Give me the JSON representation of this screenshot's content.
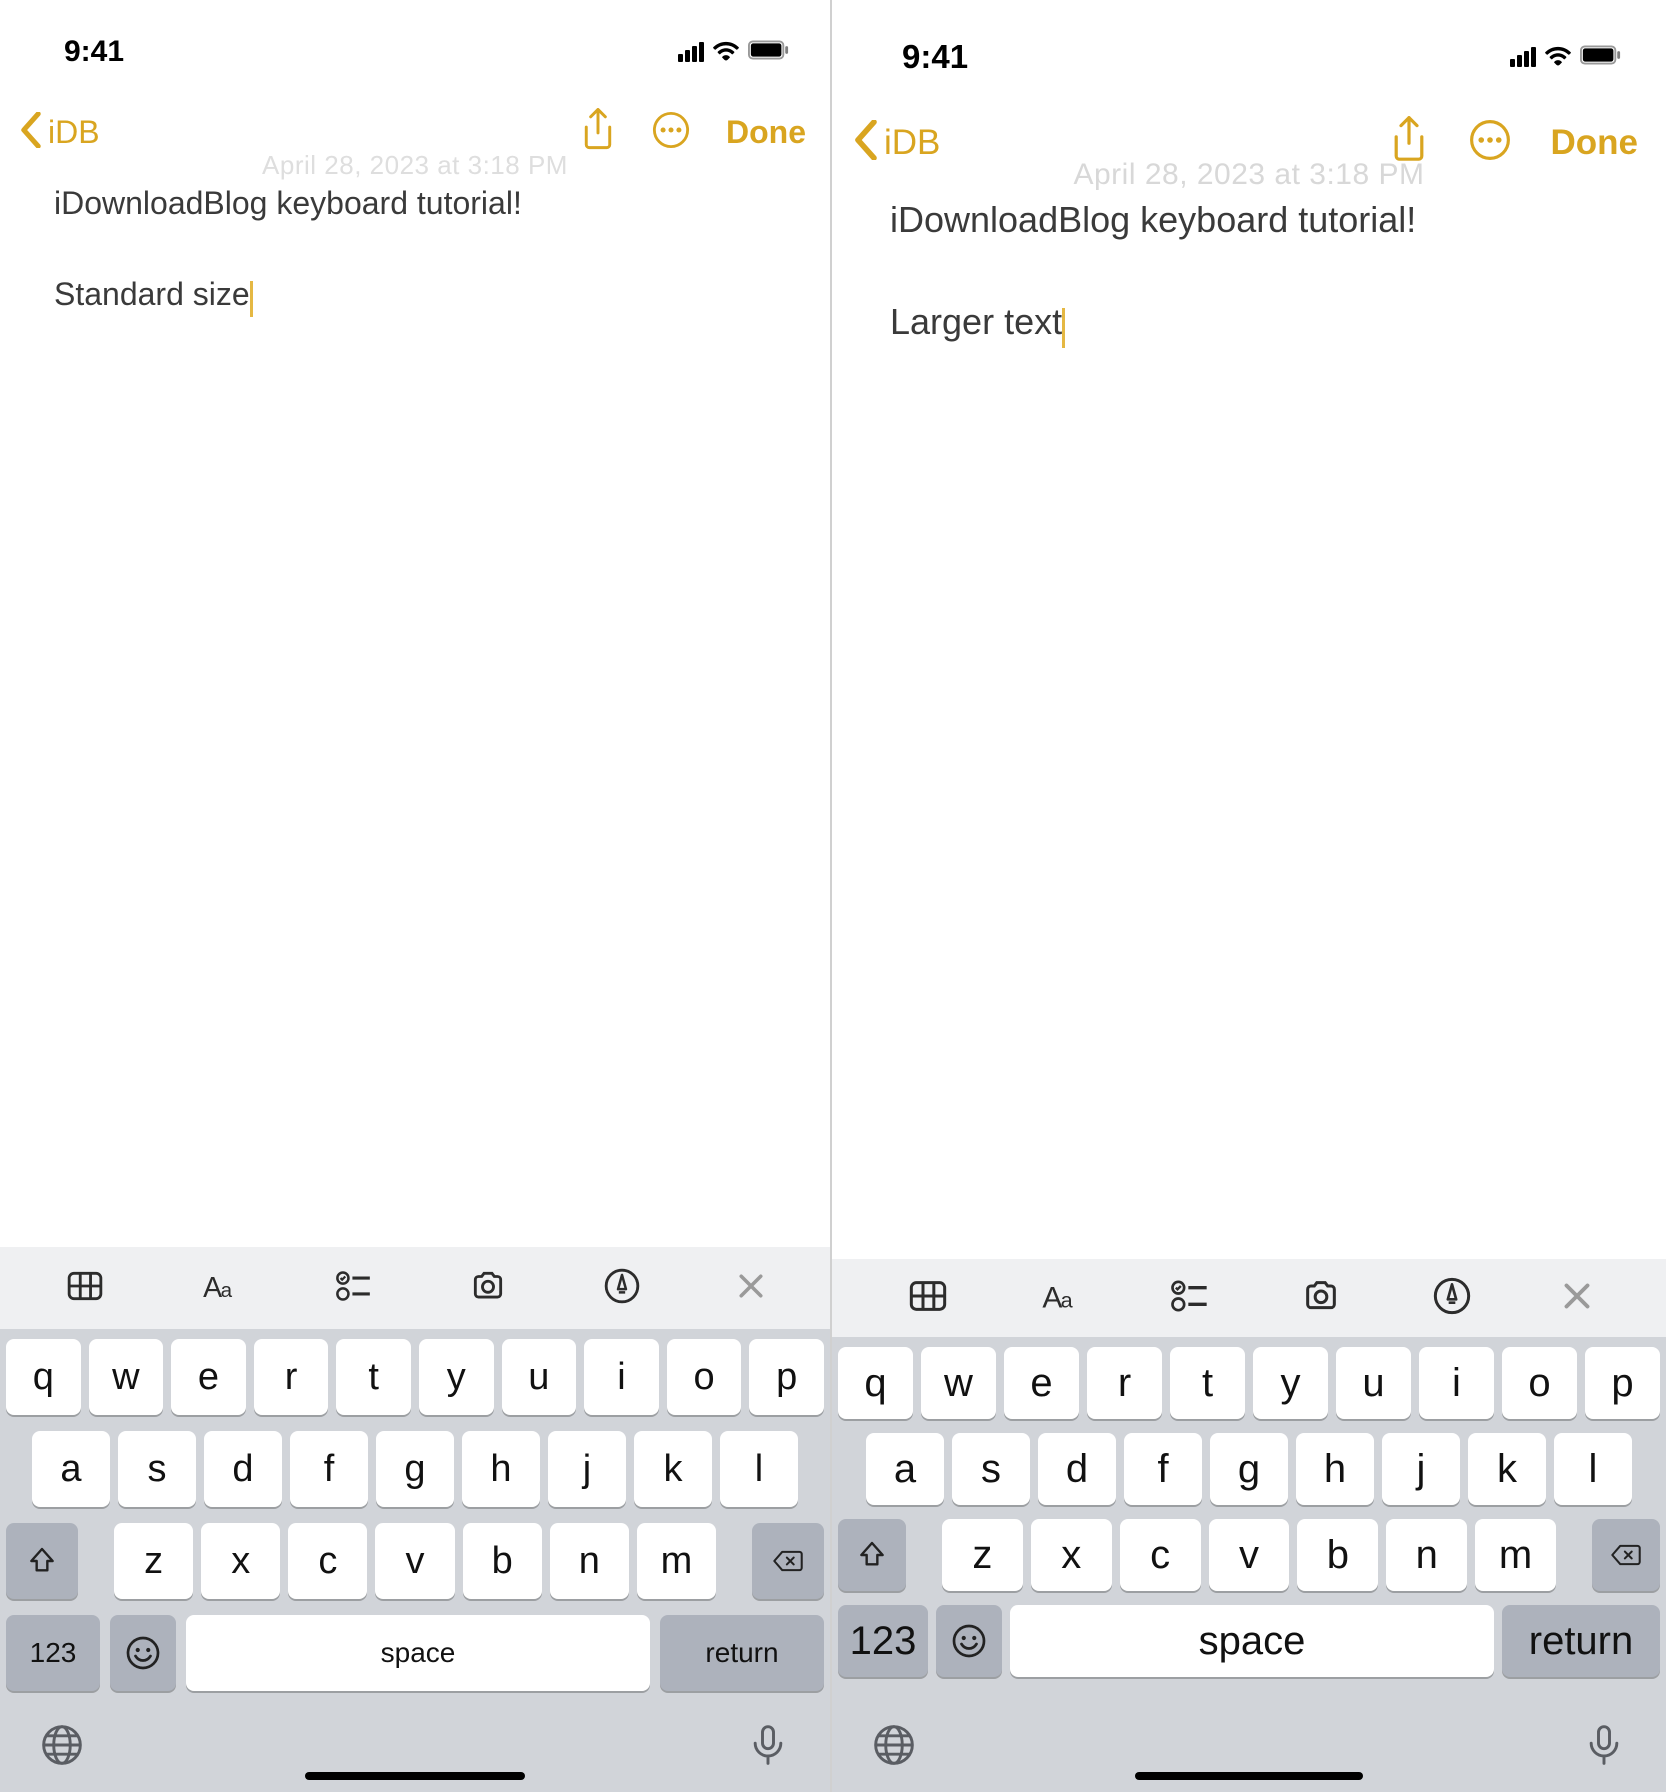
{
  "left": {
    "status": {
      "time": "9:41"
    },
    "nav": {
      "back_label": "iDB",
      "done_label": "Done"
    },
    "date_watermark": "April 28, 2023 at 3:18 PM",
    "note": {
      "title": "iDownloadBlog keyboard tutorial!",
      "body": "Standard size"
    },
    "keyboard": {
      "row1": [
        "q",
        "w",
        "e",
        "r",
        "t",
        "y",
        "u",
        "i",
        "o",
        "p"
      ],
      "row2": [
        "a",
        "s",
        "d",
        "f",
        "g",
        "h",
        "j",
        "k",
        "l"
      ],
      "row3": [
        "z",
        "x",
        "c",
        "v",
        "b",
        "n",
        "m"
      ],
      "k123": "123",
      "space": "space",
      "return": "return"
    }
  },
  "right": {
    "status": {
      "time": "9:41"
    },
    "nav": {
      "back_label": "iDB",
      "done_label": "Done"
    },
    "date_watermark": "April 28, 2023 at 3:18 PM",
    "note": {
      "title": "iDownloadBlog keyboard tutorial!",
      "body": "Larger text"
    },
    "keyboard": {
      "row1": [
        "q",
        "w",
        "e",
        "r",
        "t",
        "y",
        "u",
        "i",
        "o",
        "p"
      ],
      "row2": [
        "a",
        "s",
        "d",
        "f",
        "g",
        "h",
        "j",
        "k",
        "l"
      ],
      "row3": [
        "z",
        "x",
        "c",
        "v",
        "b",
        "n",
        "m"
      ],
      "k123": "123",
      "space": "space",
      "return": "return"
    }
  }
}
